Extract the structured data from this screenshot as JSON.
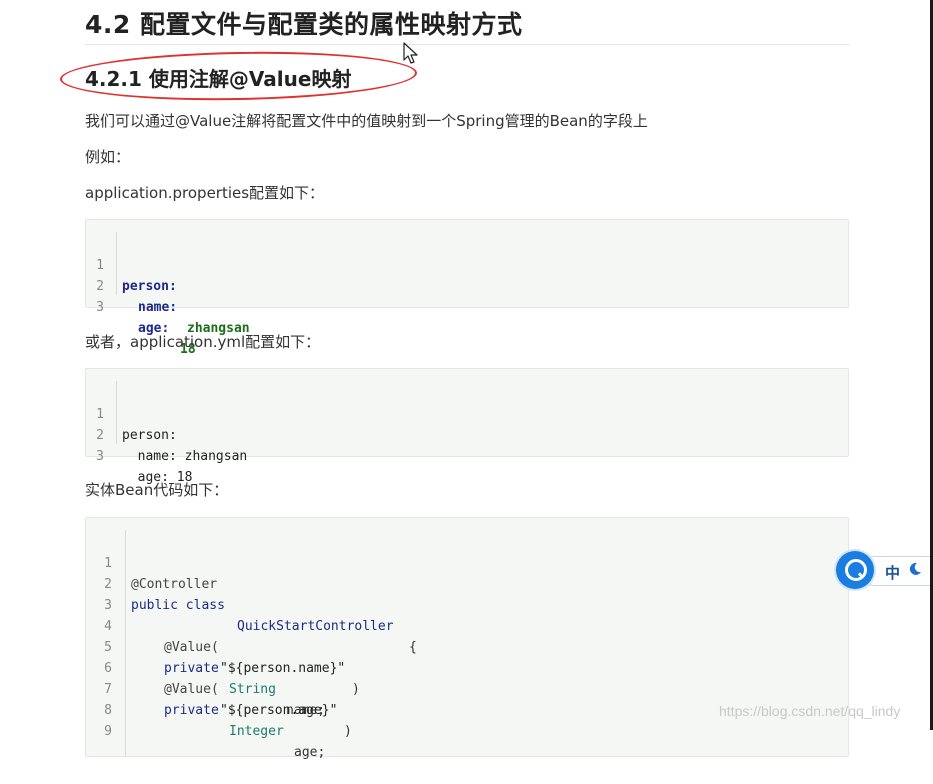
{
  "article": {
    "h2": "4.2 配置文件与配置类的属性映射方式",
    "h3": "4.2.1 使用注解@Value映射",
    "p1": "我们可以通过@Value注解将配置文件中的值映射到一个Spring管理的Bean的字段上",
    "p2": "例如：",
    "p3": "application.properties配置如下：",
    "p4": "或者，application.yml配置如下：",
    "p5": "实体Bean代码如下："
  },
  "code_block_1": {
    "line_numbers": [
      "1",
      "2",
      "3"
    ],
    "l1_key": "person:",
    "l2_key": "name:",
    "l2_val": "zhangsan",
    "l3_key": "age:",
    "l3_val": "18"
  },
  "code_block_2": {
    "line_numbers": [
      "1",
      "2",
      "3"
    ],
    "l1": "person:",
    "l2": "  name: zhangsan",
    "l3": "  age: 18"
  },
  "code_block_3": {
    "line_numbers": [
      "1",
      "2",
      "3",
      "4",
      "5",
      "6",
      "7",
      "8",
      "9"
    ],
    "l1_ann": "@Controller",
    "l2_kw": "public class",
    "l2_cls": "QuickStartController",
    "l2_brace": "{",
    "l4_ann": "@Value(",
    "l4_str": "\"${person.name}\"",
    "l4_end": ")",
    "l5_kw": "private",
    "l5_type": "String",
    "l5_name": "name;",
    "l6_ann": "@Value(",
    "l6_str": "\"${person.age}\"",
    "l6_end": ")",
    "l7_kw": "private",
    "l7_type": "Integer",
    "l7_name": "age;"
  },
  "ime_widget": {
    "mode": "中",
    "icon": "moon-icon",
    "logo": "ime-logo-icon"
  },
  "watermark": "https://blog.csdn.net/qq_lindy",
  "colors": {
    "annotation": "#e0302f",
    "code_bg": "#f5f7f4",
    "ime_blue": "#1a7de0"
  }
}
